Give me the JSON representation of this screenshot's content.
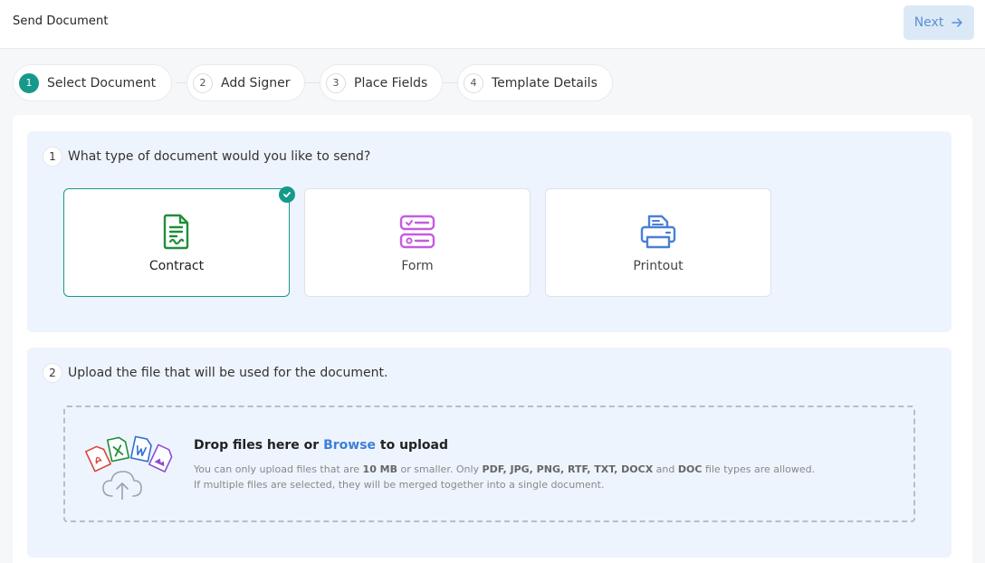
{
  "header": {
    "title": "Send Document",
    "next_label": "Next"
  },
  "steps": [
    {
      "num": "1",
      "label": "Select Document",
      "active": true
    },
    {
      "num": "2",
      "label": "Add Signer",
      "active": false
    },
    {
      "num": "3",
      "label": "Place Fields",
      "active": false
    },
    {
      "num": "4",
      "label": "Template Details",
      "active": false
    }
  ],
  "section1": {
    "num": "1",
    "question": "What type of document would you like to send?",
    "options": [
      {
        "label": "Contract",
        "icon": "contract-icon",
        "selected": true,
        "color": "#1e8f3a"
      },
      {
        "label": "Form",
        "icon": "form-icon",
        "selected": false,
        "color": "#c65be0"
      },
      {
        "label": "Printout",
        "icon": "printer-icon",
        "selected": false,
        "color": "#4a7fd6"
      }
    ]
  },
  "section2": {
    "num": "2",
    "question": "Upload the file that will be used for the document.",
    "drop_prefix": "Drop files here or ",
    "browse": "Browse",
    "drop_suffix": " to upload",
    "hint1_a": "You can only upload files that are ",
    "hint1_size": "10 MB",
    "hint1_b": " or smaller. Only ",
    "hint1_types": "PDF, JPG, PNG, RTF, TXT, DOCX",
    "hint1_c": " and ",
    "hint1_doc": "DOC",
    "hint1_d": " file types are allowed.",
    "hint2": "If multiple files are selected, they will be merged together into a single document."
  },
  "colors": {
    "accent": "#16998a",
    "link": "#3d7fd9",
    "section_bg": "#eef4fd"
  }
}
